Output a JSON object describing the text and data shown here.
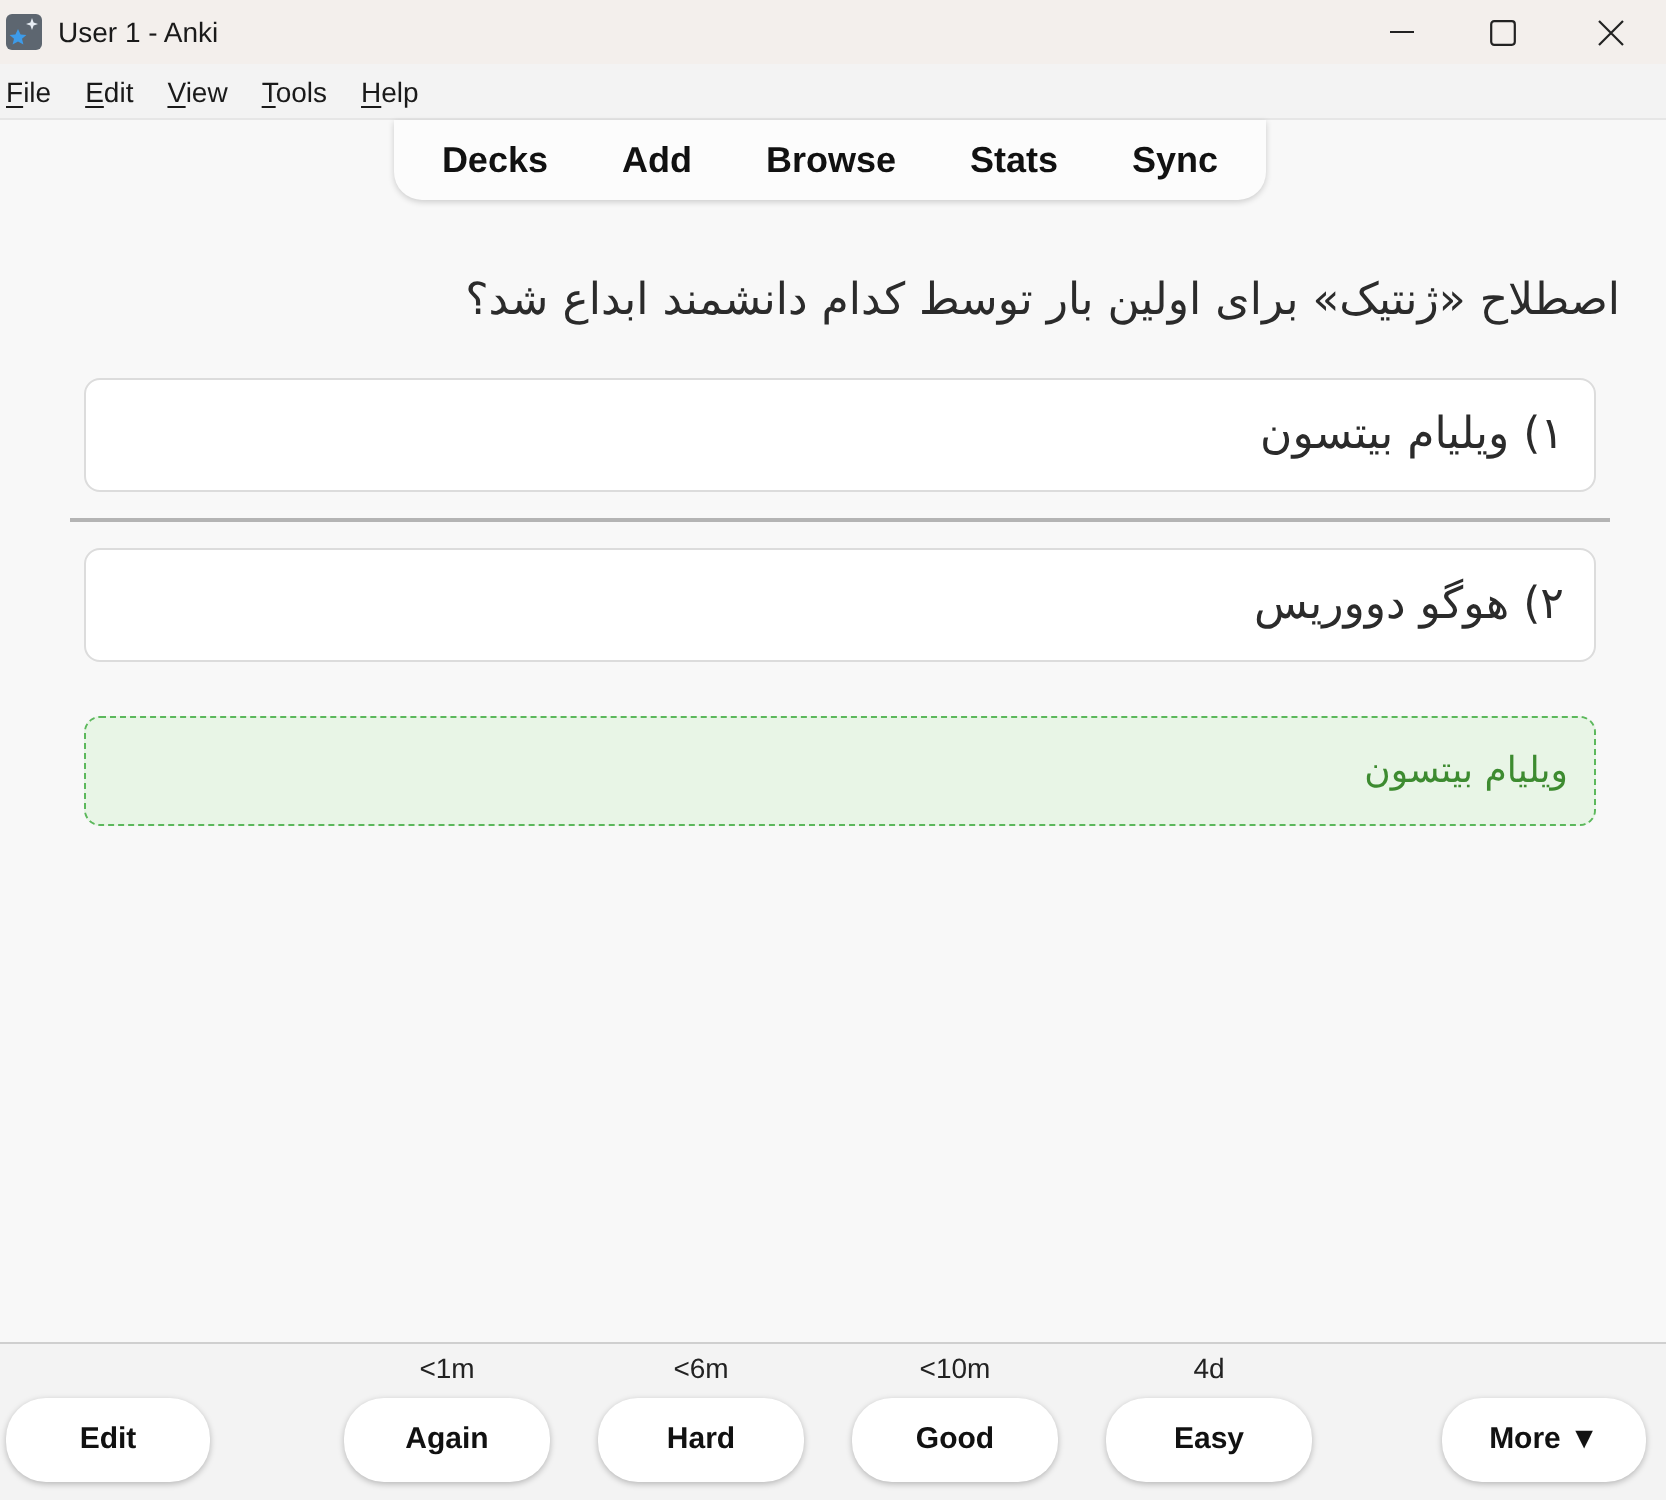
{
  "window": {
    "title": "User 1 - Anki"
  },
  "menu": [
    "File",
    "Edit",
    "View",
    "Tools",
    "Help"
  ],
  "toolbar": [
    "Decks",
    "Add",
    "Browse",
    "Stats",
    "Sync"
  ],
  "card": {
    "question": "اصطلاح «ژنتیک» برای اولین بار توسط کدام دانشمند ابداع شد؟",
    "options": [
      "۱) ویلیام بیتسون",
      "۲) هوگو دووریس"
    ],
    "answer": "ویلیام بیتسون"
  },
  "bottom_bar": {
    "edit_button": "Edit",
    "answer_buttons": [
      {
        "label": "Again",
        "interval": "<1m"
      },
      {
        "label": "Hard",
        "interval": "<6m"
      },
      {
        "label": "Good",
        "interval": "<10m"
      },
      {
        "label": "Easy",
        "interval": "4d"
      }
    ],
    "more_button": "More ▼"
  }
}
